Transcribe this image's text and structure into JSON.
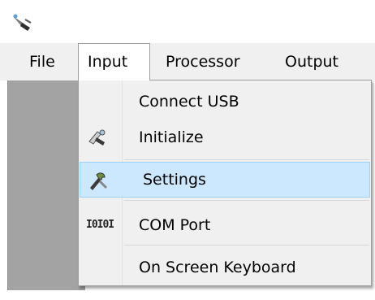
{
  "menubar": {
    "items": [
      {
        "label": "File"
      },
      {
        "label": "Input"
      },
      {
        "label": "Processor"
      },
      {
        "label": "Output"
      }
    ],
    "open_item": "Input"
  },
  "input_menu": {
    "items": [
      {
        "label": "Connect USB",
        "icon": "none"
      },
      {
        "label": "Initialize",
        "icon": "pencil-hand-icon"
      },
      {
        "label": "Settings",
        "icon": "tools-icon",
        "highlighted": true
      },
      {
        "label": "COM Port",
        "icon": "binary-icon",
        "icon_text": "I0I0I"
      },
      {
        "label": "On Screen Keyboard",
        "icon": "none"
      }
    ]
  },
  "colors": {
    "menubar_bg": "#f0f0f0",
    "highlight_bg": "#cce8ff",
    "highlight_border": "#99d1ff",
    "panel_gray": "#a3a3a3"
  }
}
